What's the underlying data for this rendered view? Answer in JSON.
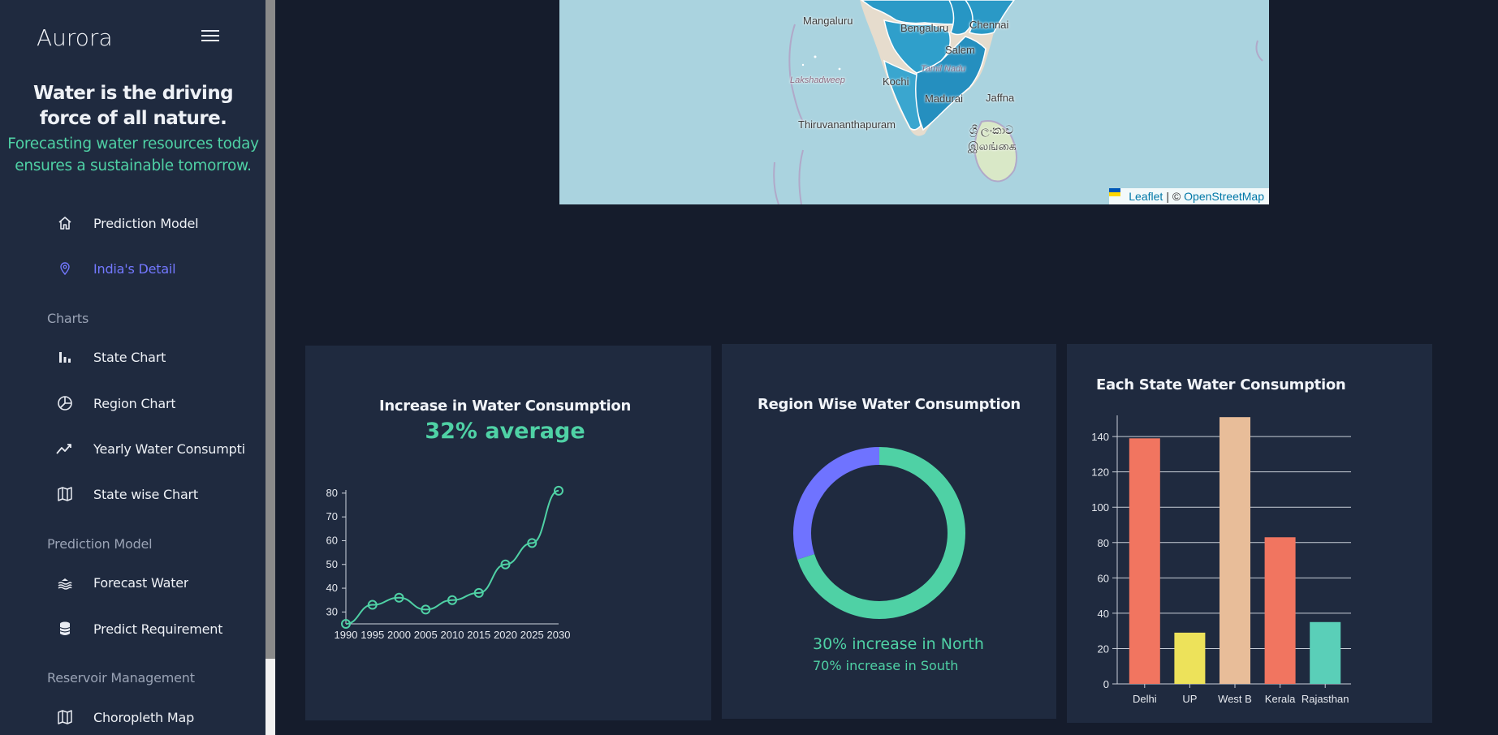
{
  "app": {
    "brand": "Aurora"
  },
  "hero": {
    "quote": "Water is the driving force of all nature.",
    "tagline": "Forecasting water resources today ensures a sustainable tomorrow."
  },
  "sidebar": {
    "items": [
      {
        "label": "Prediction Model",
        "icon": "home-icon",
        "active": false
      },
      {
        "label": "India's Detail",
        "icon": "location-pin-icon",
        "active": true
      }
    ],
    "sections": [
      {
        "title": "Charts",
        "items": [
          {
            "label": "State Chart",
            "icon": "bar-chart-icon"
          },
          {
            "label": "Region Chart",
            "icon": "pie-chart-icon"
          },
          {
            "label": "Yearly Water Consumpti",
            "icon": "trend-line-icon"
          },
          {
            "label": "State wise Chart",
            "icon": "map-icon"
          }
        ]
      },
      {
        "title": "Prediction Model",
        "items": [
          {
            "label": "Forecast Water",
            "icon": "water-icon"
          },
          {
            "label": "Predict Requirement",
            "icon": "database-icon"
          }
        ]
      },
      {
        "title": "Reservoir Management",
        "items": [
          {
            "label": "Choropleth Map",
            "icon": "map-icon"
          }
        ]
      }
    ]
  },
  "map": {
    "labels": [
      "Mangaluru",
      "Bengaluru",
      "Chennai",
      "Salem",
      "Tamil Nadu",
      "Lakshadweep",
      "Kochi",
      "Madurai",
      "Jaffna",
      "Thiruvananthapuram",
      "ශ්‍රී ලංකාව",
      "இலங்கை"
    ],
    "attribution": {
      "leaflet": "Leaflet",
      "separator": "| ©",
      "osm": "OpenStreetMap"
    },
    "colors": {
      "sea": "#aad3df",
      "region": "#2b9ac7"
    }
  },
  "cards": {
    "line": {
      "title": "Increase in Water Consumption",
      "stat": "32% average"
    },
    "donut": {
      "title": "Region Wise Water Consumption",
      "line1": "30% increase in North",
      "line2": "70% increase in South"
    },
    "bar": {
      "title": "Each State Water Consumption"
    }
  },
  "chart_data": [
    {
      "type": "line",
      "x": [
        1990,
        1995,
        2000,
        2005,
        2010,
        2015,
        2020,
        2025,
        2030
      ],
      "values": [
        25,
        33,
        36,
        31,
        35,
        38,
        50,
        59,
        81
      ],
      "yticks": [
        30,
        40,
        50,
        60,
        70,
        80
      ],
      "ylim": [
        25,
        82
      ],
      "color": "#4fd1a5"
    },
    {
      "type": "pie",
      "categories": [
        "North",
        "South"
      ],
      "values": [
        30,
        70
      ],
      "colors": [
        "#6f73ff",
        "#4fd1a5"
      ],
      "donut": true
    },
    {
      "type": "bar",
      "categories": [
        "Delhi",
        "UP",
        "West B",
        "Kerala",
        "Rajasthan"
      ],
      "values": [
        139,
        29,
        151,
        83,
        35
      ],
      "colors": [
        "#f17560",
        "#ede25a",
        "#e8bd99",
        "#f17560",
        "#5acfb8"
      ],
      "yticks": [
        0,
        20,
        40,
        60,
        80,
        100,
        120,
        140
      ],
      "ylim": [
        0,
        152
      ]
    }
  ]
}
